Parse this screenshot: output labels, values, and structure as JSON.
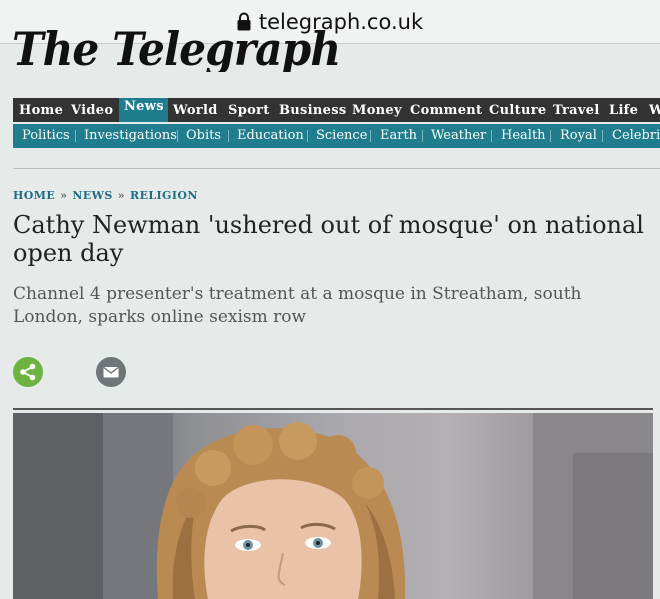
{
  "browser": {
    "url": "telegraph.co.uk"
  },
  "masthead": {
    "title": "The Telegraph"
  },
  "main_nav": {
    "items": [
      "Home",
      "Video",
      "News",
      "World",
      "Sport",
      "Business",
      "Money",
      "Comment",
      "Culture",
      "Travel",
      "Life",
      "W"
    ],
    "active": "News"
  },
  "sub_nav": {
    "items": [
      "Politics",
      "Investigations",
      "Obits",
      "Education",
      "Science",
      "Earth",
      "Weather",
      "Health",
      "Royal",
      "Celebrit"
    ]
  },
  "breadcrumb": {
    "items": [
      "HOME",
      "NEWS",
      "RELIGION"
    ],
    "separator": "»"
  },
  "article": {
    "headline": "Cathy Newman 'ushered out of mosque' on national open day",
    "standfirst": "Channel 4 presenter's treatment at a mosque in Streatham, south London, sparks online sexism row"
  },
  "share": {
    "share_icon": "share-icon",
    "email_icon": "email-icon"
  },
  "colors": {
    "nav_dark": "#333333",
    "accent_teal": "#1f7d8e",
    "share_green": "#6cb33f",
    "email_grey": "#707579"
  }
}
